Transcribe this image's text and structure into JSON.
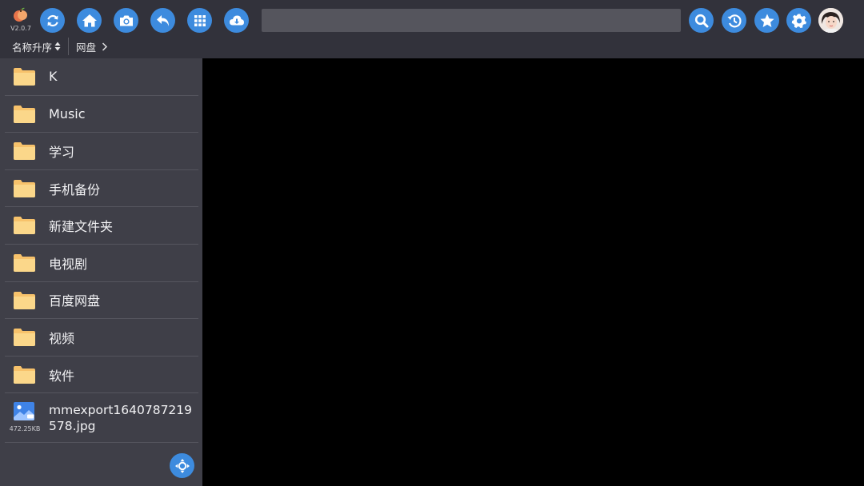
{
  "app": {
    "version": "V2.0.7",
    "accent_color": "#3d8bde",
    "logo_icon": "app-logo-fruit"
  },
  "toolbar": {
    "left_buttons": [
      {
        "icon": "refresh-icon"
      },
      {
        "icon": "home-icon"
      },
      {
        "icon": "camera-icon"
      },
      {
        "icon": "back-icon"
      },
      {
        "icon": "grid-apps-icon"
      },
      {
        "icon": "cloud-download-icon"
      }
    ],
    "search": {
      "value": "",
      "placeholder": ""
    },
    "right_buttons": [
      {
        "icon": "search-icon"
      },
      {
        "icon": "history-icon"
      },
      {
        "icon": "star-icon"
      },
      {
        "icon": "gear-icon"
      }
    ],
    "avatar_icon": "user-avatar"
  },
  "sortbar": {
    "sort_label": "名称升序",
    "breadcrumb": [
      "网盘"
    ]
  },
  "files": {
    "folders": [
      {
        "name": "K"
      },
      {
        "name": "Music"
      },
      {
        "name": "学习"
      },
      {
        "name": "手机备份"
      },
      {
        "name": "新建文件夹"
      },
      {
        "name": "电视剧"
      },
      {
        "name": "百度网盘"
      },
      {
        "name": "视频"
      },
      {
        "name": "软件"
      }
    ],
    "file": {
      "name": "mmexport1640787219578.jpg",
      "size": "472.25KB",
      "icon": "image-file-icon"
    }
  },
  "nav_button": {
    "icon": "dpad-navigate-icon"
  }
}
